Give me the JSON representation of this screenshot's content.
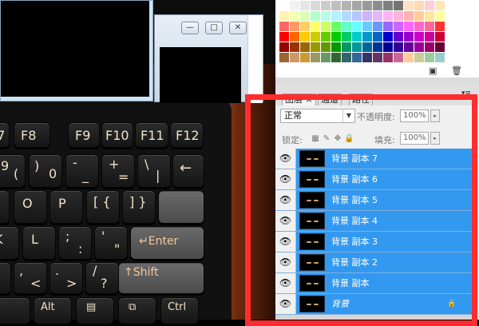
{
  "keyboard": {
    "row1": [
      "F7",
      "F8",
      "F9",
      "F10",
      "F11",
      "F12"
    ],
    "row2": [
      {
        "top": "(",
        "bottom": "9"
      },
      {
        "top": ")",
        "bottom": "0"
      },
      {
        "top": "-",
        "bottom": "_"
      },
      {
        "top": "+",
        "bottom": "="
      },
      {
        "top": "\\",
        "bottom": "|"
      }
    ],
    "row3": [
      "O",
      "P",
      "[ {",
      "] }"
    ],
    "row4": [
      "K",
      "L",
      ";",
      "'"
    ],
    "row4_sub": [
      ":",
      "\""
    ],
    "row5": [
      "<",
      ">",
      "?",
      "/"
    ],
    "row5_top": [
      ",",
      ".",
      "/"
    ],
    "row6": [
      "Alt",
      "Ctrl"
    ],
    "backspace_arrow": "←",
    "enter_label": "↵Enter",
    "shift_label": "↑Shift"
  },
  "window2": {
    "controls": [
      "—",
      "□",
      "✕"
    ]
  },
  "swatches": {
    "colors": [
      "#ffffff",
      "#f2f2f2",
      "#e6e6e6",
      "#d9d9d9",
      "#cccccc",
      "#bfbfbf",
      "#b3b3b3",
      "#a6a6a6",
      "#999999",
      "#8c8c8c",
      "#808080",
      "#737373",
      "#ffe0c0",
      "#ffd9b3",
      "#ffccd9",
      "#ffe6b3",
      "#fff2b3",
      "#f2ffb3",
      "#d9ffb3",
      "#b3ffcc",
      "#b3ffe6",
      "#b3f2ff",
      "#b3d9ff",
      "#b3c6ff",
      "#ccb3ff",
      "#e6b3ff",
      "#ffb3f2",
      "#ffb3d9",
      "#ffb3b3",
      "#ffcc99",
      "#ffe699",
      "#ffff99",
      "#ff6666",
      "#ff9966",
      "#ffcc66",
      "#ffff66",
      "#ccff66",
      "#66ff66",
      "#66ffcc",
      "#66ffff",
      "#66ccff",
      "#6699ff",
      "#9966ff",
      "#cc66ff",
      "#ff66ff",
      "#ff66cc",
      "#ff6699",
      "#ff3333",
      "#ff0000",
      "#ff6600",
      "#ffcc00",
      "#cccc00",
      "#66cc00",
      "#00cc00",
      "#00cc66",
      "#00cccc",
      "#0099cc",
      "#0066cc",
      "#0000cc",
      "#6600cc",
      "#9900cc",
      "#cc00cc",
      "#cc0099",
      "#cc0033",
      "#990000",
      "#993300",
      "#996600",
      "#999900",
      "#669900",
      "#009900",
      "#009966",
      "#009999",
      "#006699",
      "#003399",
      "#000099",
      "#330099",
      "#660099",
      "#990099",
      "#990066",
      "#660033",
      "#996633",
      "#cc9966",
      "#cc9933",
      "#999966",
      "#669966",
      "#336633",
      "#336666",
      "#336699",
      "#333366",
      "#663366",
      "#993366",
      "#cc6699",
      "#ffcc99",
      "#cccc99",
      "#99cc99",
      "#99cccc"
    ]
  },
  "panel": {
    "tabs": [
      "图层 ×",
      "通道",
      "路径"
    ],
    "blend_mode": "正常",
    "opacity_label": "不透明度:",
    "opacity_value": "100%",
    "lock_label": "锁定:",
    "fill_label": "填充:",
    "fill_value": "100%"
  },
  "layers": [
    {
      "name": "背景 副本 7",
      "selected": true
    },
    {
      "name": "背景 副本 6",
      "selected": true
    },
    {
      "name": "背景 副本 5",
      "selected": true
    },
    {
      "name": "背景 副本 4",
      "selected": true
    },
    {
      "name": "背景 副本 3",
      "selected": true
    },
    {
      "name": "背景 副本 2",
      "selected": true
    },
    {
      "name": "背景 副本",
      "selected": true
    },
    {
      "name": "背景",
      "selected": true,
      "locked": true
    }
  ]
}
